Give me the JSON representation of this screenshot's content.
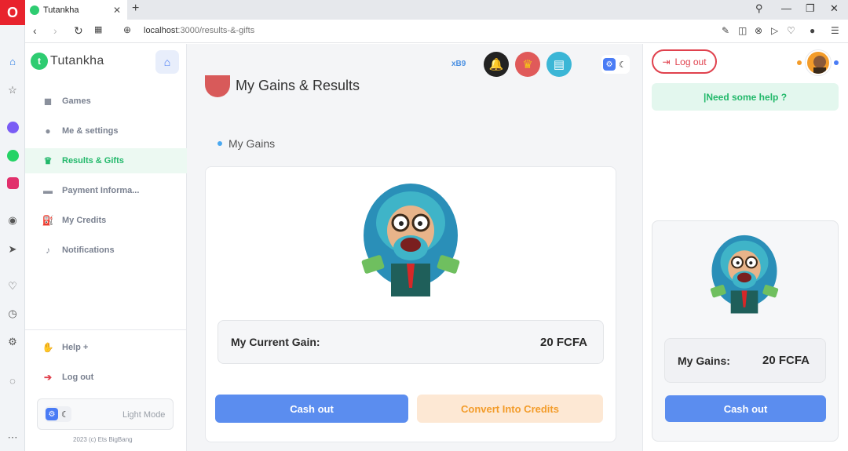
{
  "browser": {
    "tab_title": "Tutankha",
    "tab_close": "✕",
    "new_tab": "+",
    "url_host": "localhost",
    "url_path": ":3000/results-&-gifts",
    "win_search": "⚲",
    "win_minimize": "—",
    "win_restore": "❐",
    "win_close": "✕"
  },
  "app": {
    "brand": "Tutankha",
    "nav": [
      {
        "label": "Games",
        "icon": "gamepad-icon"
      },
      {
        "label": "Me & settings",
        "icon": "user-icon"
      },
      {
        "label": "Results & Gifts",
        "icon": "trophy-icon",
        "active": true
      },
      {
        "label": "Payment Informa...",
        "icon": "card-icon"
      },
      {
        "label": "My Credits",
        "icon": "credits-icon"
      },
      {
        "label": "Notifications",
        "icon": "bell-icon"
      }
    ],
    "bottom_nav": [
      {
        "label": "Help +",
        "icon": "help-icon"
      },
      {
        "label": "Log out",
        "icon": "logout-icon"
      }
    ],
    "mode_label": "Light Mode",
    "copyright": "2023 (c) Ets BigBang",
    "accent": "#21b86a",
    "primary": "#5b8def"
  },
  "main": {
    "page_title": "My Gains & Results",
    "top_badge": "xB9",
    "section_title": "My Gains",
    "current_gain_label": "My Current Gain:",
    "current_gain_value": "20 FCFA",
    "cashout_label": "Cash out",
    "convert_label": "Convert Into Credits"
  },
  "right": {
    "logout_label": "Log out",
    "help_label": "|Need some help ?",
    "mini_gain_label": "My Gains:",
    "mini_gain_value": "20 FCFA",
    "mini_cashout_label": "Cash out"
  }
}
